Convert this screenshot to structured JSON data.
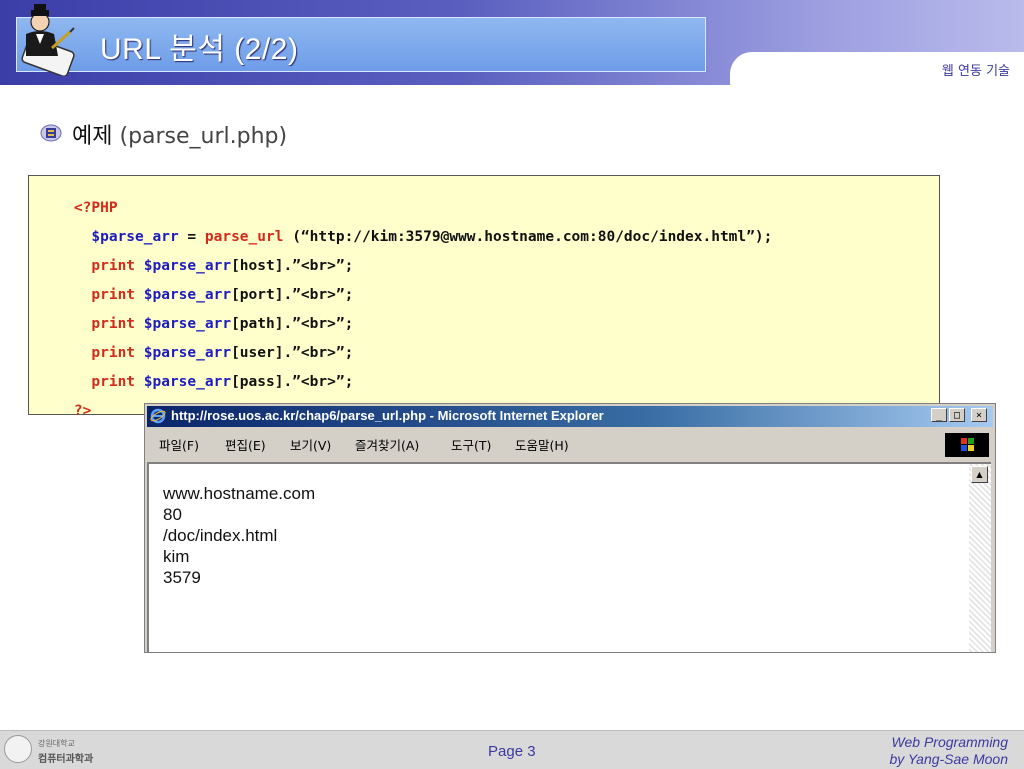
{
  "header": {
    "title": "URL 분석 (2/2)",
    "section_label": "웹 연동 기술"
  },
  "bullet": {
    "text_main": "예제",
    "text_paren": "(parse_url.php)"
  },
  "code": {
    "lines": [
      [
        {
          "t": "<?PHP",
          "c": "kw"
        }
      ],
      [
        {
          "t": "  $parse_arr",
          "c": "var"
        },
        {
          "t": " = ",
          "c": "blk"
        },
        {
          "t": "parse_url",
          "c": "kw"
        },
        {
          "t": " (“http://kim:3579@www.hostname.com:80/doc/index.html”);",
          "c": "blk"
        }
      ],
      [
        {
          "t": "  print ",
          "c": "kw"
        },
        {
          "t": "$parse_arr",
          "c": "var"
        },
        {
          "t": "[host].”<br>”;",
          "c": "blk"
        }
      ],
      [
        {
          "t": "  print ",
          "c": "kw"
        },
        {
          "t": "$parse_arr",
          "c": "var"
        },
        {
          "t": "[port].”<br>”;",
          "c": "blk"
        }
      ],
      [
        {
          "t": "  print ",
          "c": "kw"
        },
        {
          "t": "$parse_arr",
          "c": "var"
        },
        {
          "t": "[path].”<br>”;",
          "c": "blk"
        }
      ],
      [
        {
          "t": "  print ",
          "c": "kw"
        },
        {
          "t": "$parse_arr",
          "c": "var"
        },
        {
          "t": "[user].”<br>”;",
          "c": "blk"
        }
      ],
      [
        {
          "t": "  print ",
          "c": "kw"
        },
        {
          "t": "$parse_arr",
          "c": "var"
        },
        {
          "t": "[pass].”<br>”;",
          "c": "blk"
        }
      ],
      [
        {
          "t": "?>",
          "c": "kw"
        }
      ]
    ]
  },
  "browser": {
    "title": "http://rose.uos.ac.kr/chap6/parse_url.php - Microsoft Internet Explorer",
    "window_buttons": [
      "_",
      "□",
      "×"
    ],
    "menu": [
      "파일(F)",
      "편집(E)",
      "보기(V)",
      "즐겨찾기(A)",
      "도구(T)",
      "도움말(H)"
    ],
    "output": [
      "www.hostname.com",
      "80",
      "/doc/index.html",
      "kim",
      "3579"
    ]
  },
  "footer": {
    "logo_line1": "강원대학교",
    "logo_line2": "컴퓨터과학과",
    "page": "Page 3",
    "course_line1": "Web Programming",
    "course_line2": "by Yang-Sae Moon"
  },
  "colors": {
    "keyword": "#d42a1c",
    "variable": "#1c1cc0",
    "code_bg": "#ffffcc",
    "accent": "#3a3aa0"
  }
}
